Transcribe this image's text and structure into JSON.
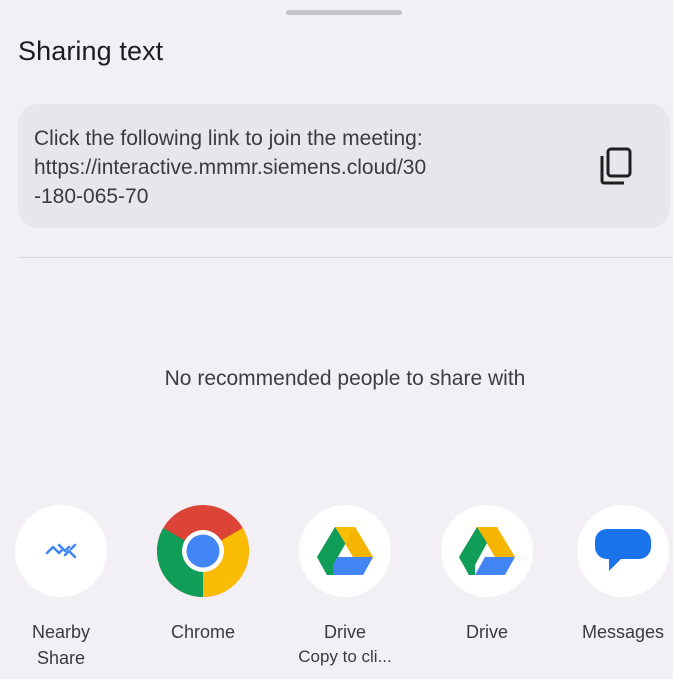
{
  "sheet": {
    "title": "Sharing text",
    "shared_text": "Click the following link to join the meeting:\nhttps://interactive.mmmr.siemens.cloud/30\n-180-065-70",
    "copy_icon": "copy-icon",
    "empty_message": "No recommended people to share with"
  },
  "apps": [
    {
      "label": "Nearby\nShare",
      "sublabel": "",
      "icon": "nearby-share-icon"
    },
    {
      "label": "Chrome",
      "sublabel": "",
      "icon": "chrome-icon"
    },
    {
      "label": "Drive",
      "sublabel": "Copy to cli...",
      "icon": "drive-icon"
    },
    {
      "label": "Drive",
      "sublabel": "",
      "icon": "drive-icon"
    },
    {
      "label": "Messages",
      "sublabel": "",
      "icon": "messages-icon"
    }
  ],
  "colors": {
    "background": "#f2f0f4",
    "card": "#e8e6eb",
    "nearby_accent": "#4285f4",
    "messages_blue": "#1a73e8"
  }
}
